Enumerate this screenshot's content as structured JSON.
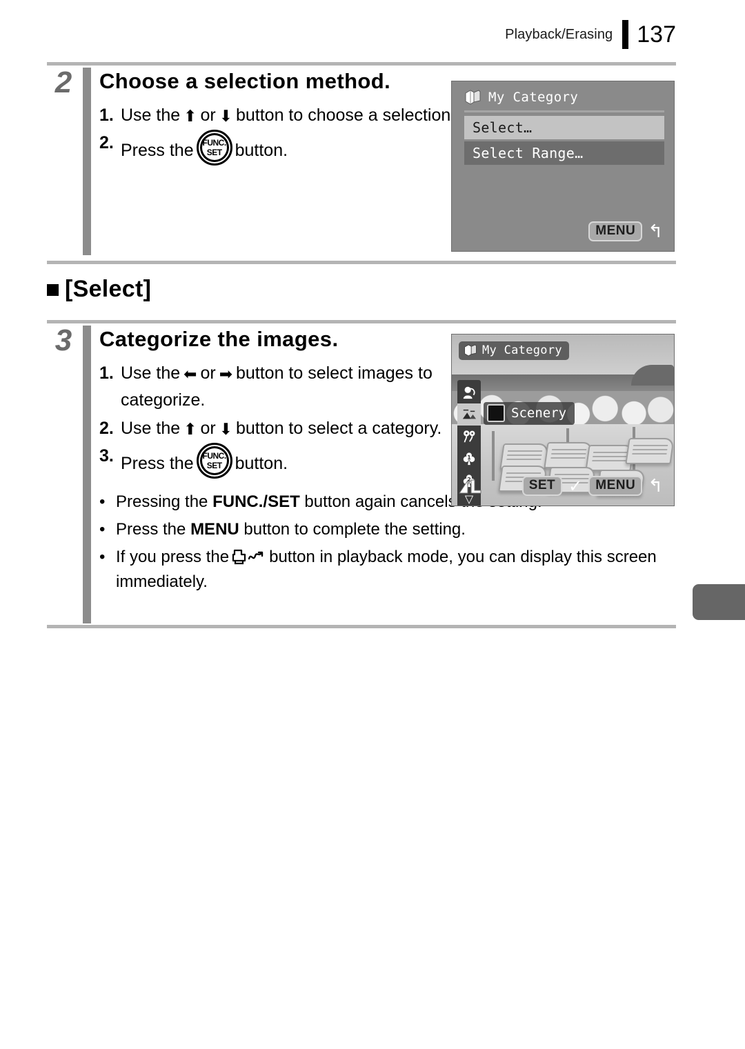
{
  "header": {
    "title": "Playback/Erasing",
    "page_number": "137"
  },
  "steps": [
    {
      "number": "2",
      "title": "Choose a selection method.",
      "items": [
        {
          "marker": "1.",
          "text_before": "Use the",
          "icon_a": "arrow-up",
          "conjunction": "or",
          "icon_b": "arrow-down",
          "text_after": "button to choose a selection method."
        },
        {
          "marker": "2.",
          "text_before": "Press the",
          "icon": "func-set-button",
          "text_after": "button."
        }
      ]
    },
    {
      "number": "3",
      "title": "Categorize the images.",
      "items": [
        {
          "marker": "1.",
          "text_before": "Use the",
          "icon_a": "arrow-left",
          "conjunction": "or",
          "icon_b": "arrow-right",
          "text_after": "button to select images to categorize."
        },
        {
          "marker": "2.",
          "text_before": "Use the",
          "icon_a": "arrow-up",
          "conjunction": "or",
          "icon_b": "arrow-down",
          "text_after": "button to select a category."
        },
        {
          "marker": "3.",
          "text_before": "Press the",
          "icon": "func-set-button",
          "text_after": "button."
        }
      ]
    }
  ],
  "section_heading": {
    "bullet": "square-bullet",
    "label": "[Select]"
  },
  "notes": [
    {
      "dot": "•",
      "before": "Pressing the",
      "bold": "FUNC./SET",
      "after": "button again cancels the setting."
    },
    {
      "dot": "•",
      "before": "Press the",
      "bold": "MENU",
      "after": "button to complete the setting."
    },
    {
      "dot": "•",
      "before": "If you press the",
      "icon": "print-share-button",
      "after": "button in playback mode, you can display this screen immediately."
    }
  ],
  "lcd_menu_screen": {
    "title": "My Category",
    "title_icon": "my-category-icon",
    "rows": [
      {
        "label": "Select…",
        "state": "selected"
      },
      {
        "label": "Select Range…",
        "state": "normal"
      }
    ],
    "bottom": {
      "menu_label": "MENU",
      "return_icon": "↰"
    }
  },
  "lcd_photo_screen": {
    "badge_label": "My Category",
    "badge_icon": "my-category-icon",
    "category_label": "Scenery",
    "category_checkbox": "unchecked",
    "strip_icons": [
      {
        "name": "people-icon",
        "state": "normal"
      },
      {
        "name": "scenery-icon",
        "state": "active"
      },
      {
        "name": "events-icon",
        "state": "normal"
      },
      {
        "name": "category-1-icon",
        "state": "normal"
      },
      {
        "name": "category-2-icon",
        "state": "normal"
      },
      {
        "name": "chevron-down-icon",
        "state": "normal"
      }
    ],
    "quality_badge": "L",
    "bottom": {
      "set_label": "SET",
      "check_icon": "✓",
      "menu_label": "MENU",
      "return_icon": "↰"
    }
  },
  "glyphs": {
    "arrow_up": "⬆",
    "arrow_down": "⬇",
    "arrow_left": "⬅",
    "arrow_right": "➡",
    "func": "FUNC.",
    "set": "SET"
  },
  "colors": {
    "rule": "#b4b4b4",
    "step_bar": "#8c8c8c",
    "step_number": "#6b6b6b",
    "lcd_background": "#8a8a8a",
    "row_selected": "#c3c3c3",
    "row_normal": "#6d6d6d",
    "thumb_tab": "#666666"
  }
}
